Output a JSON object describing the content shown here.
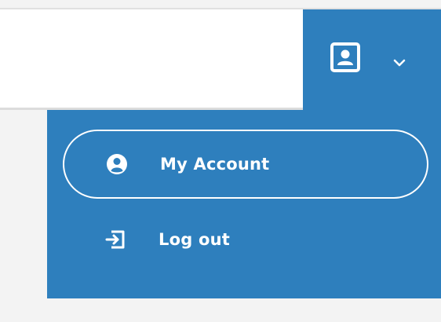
{
  "header": {
    "user_icon": "user-portrait-icon",
    "chevron_icon": "chevron-down-icon"
  },
  "menu": {
    "items": [
      {
        "label": "My Account",
        "icon": "user-circle-icon"
      },
      {
        "label": "Log out",
        "icon": "logout-icon"
      }
    ]
  },
  "colors": {
    "accent": "#2e7fbd",
    "text_on_accent": "#ffffff",
    "page_background": "#f3f3f3",
    "header_background": "#ffffff"
  }
}
